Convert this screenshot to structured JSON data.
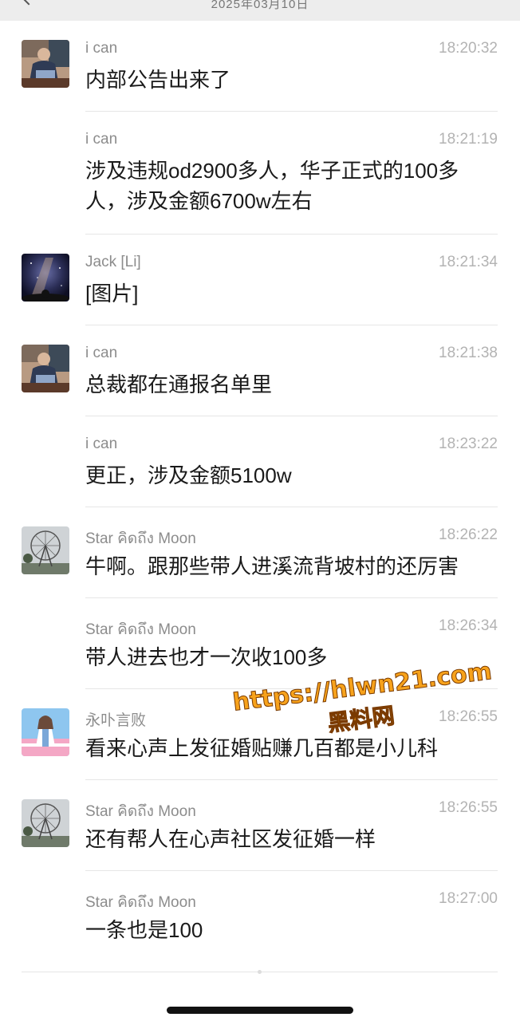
{
  "header": {
    "date": "2025年03月10日"
  },
  "messages": [
    {
      "name": "i can",
      "time": "18:20:32",
      "text": "内部公告出来了",
      "avatar": "person-photo-avatar",
      "show_avatar": true
    },
    {
      "name": "i can",
      "time": "18:21:19",
      "text": "涉及违规od2900多人，华子正式的100多人，涉及金额6700w左右",
      "avatar": "",
      "show_avatar": false
    },
    {
      "name": "Jack [Li]",
      "time": "18:21:34",
      "text": "[图片]",
      "avatar": "night-sky-avatar",
      "show_avatar": true
    },
    {
      "name": "i can",
      "time": "18:21:38",
      "text": "总裁都在通报名单里",
      "avatar": "person-photo-avatar",
      "show_avatar": true
    },
    {
      "name": "i can",
      "time": "18:23:22",
      "text": "更正，涉及金额5100w",
      "avatar": "",
      "show_avatar": false
    },
    {
      "name": "Star คิดถึง Moon",
      "time": "18:26:22",
      "text": "牛啊。跟那些带人进溪流背坡村的还厉害",
      "avatar": "ferris-wheel-avatar",
      "show_avatar": true
    },
    {
      "name": "Star คิดถึง Moon",
      "time": "18:26:34",
      "text": "带人进去也才一次收100多",
      "avatar": "",
      "show_avatar": false
    },
    {
      "name": "永卟言败",
      "time": "18:26:55",
      "text": "看来心声上发征婚贴赚几百都是小儿科",
      "avatar": "anime-girl-avatar",
      "show_avatar": true
    },
    {
      "name": "Star คิดถึง Moon",
      "time": "18:26:55",
      "text": "还有帮人在心声社区发征婚一样",
      "avatar": "ferris-wheel-avatar",
      "show_avatar": true
    },
    {
      "name": "Star คิดถึง Moon",
      "time": "18:27:00",
      "text": "一条也是100",
      "avatar": "",
      "show_avatar": false
    }
  ],
  "watermark": {
    "url": "https://hlwn21.com",
    "label": "黑料网"
  }
}
